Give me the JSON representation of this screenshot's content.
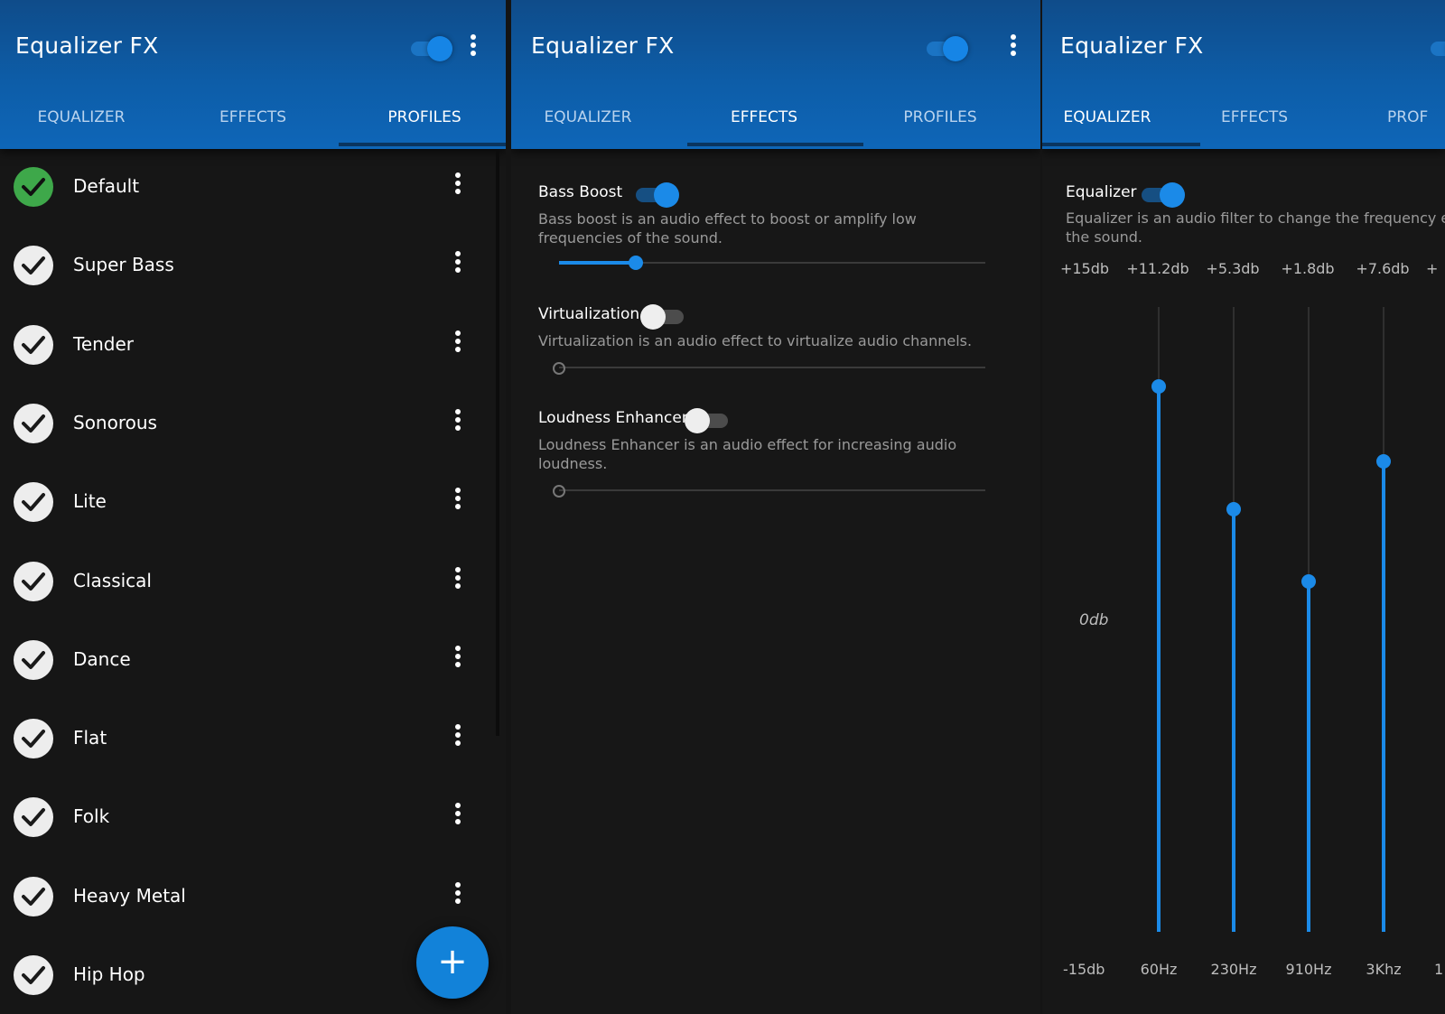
{
  "colors": {
    "accent": "#1b8ae8",
    "appbar": "#0d5da8",
    "background": "#161616",
    "check_active": "#3ea84a"
  },
  "panel_profiles": {
    "title": "Equalizer FX",
    "tabs": [
      "EQUALIZER",
      "EFFECTS",
      "PROFILES"
    ],
    "active_tab": "PROFILES",
    "profiles": [
      {
        "label": "Default",
        "selected": true
      },
      {
        "label": "Super Bass",
        "selected": false
      },
      {
        "label": "Tender",
        "selected": false
      },
      {
        "label": "Sonorous",
        "selected": false
      },
      {
        "label": "Lite",
        "selected": false
      },
      {
        "label": "Classical",
        "selected": false
      },
      {
        "label": "Dance",
        "selected": false
      },
      {
        "label": "Flat",
        "selected": false
      },
      {
        "label": "Folk",
        "selected": false
      },
      {
        "label": "Heavy Metal",
        "selected": false
      },
      {
        "label": "Hip Hop",
        "selected": false
      }
    ],
    "fab_label": "+"
  },
  "panel_effects": {
    "title": "Equalizer FX",
    "tabs": [
      "EQUALIZER",
      "EFFECTS",
      "PROFILES"
    ],
    "active_tab": "EFFECTS",
    "effects": [
      {
        "name": "Bass Boost",
        "enabled": true,
        "description_lines": [
          "Bass boost is an audio effect to boost or amplify low",
          "frequencies of the sound."
        ],
        "level": 0.18
      },
      {
        "name": "Virtualization",
        "enabled": false,
        "description_lines": [
          "Virtualization is an audio effect to virtualize audio channels."
        ],
        "level": 0
      },
      {
        "name": "Loudness Enhancer",
        "enabled": false,
        "description_lines": [
          "Loudness Enhancer is an audio effect for increasing audio",
          "loudness."
        ],
        "level": 0
      }
    ]
  },
  "panel_equalizer": {
    "title": "Equalizer FX",
    "tabs": [
      "EQUALIZER",
      "EFFECTS",
      "PROF"
    ],
    "active_tab": "EQUALIZER",
    "equalizer_label": "Equalizer",
    "equalizer_enabled": true,
    "description_lines": [
      "Equalizer is an audio filter to change the frequency enve",
      "the sound."
    ],
    "max_db_label": "+15db",
    "mid_db_label": "0db",
    "min_db_label": "-15db",
    "bands": [
      {
        "freq": "60Hz",
        "gain_label": "+11.2db",
        "gain": 11.2
      },
      {
        "freq": "230Hz",
        "gain_label": "+5.3db",
        "gain": 5.3
      },
      {
        "freq": "910Hz",
        "gain_label": "+1.8db",
        "gain": 1.8
      },
      {
        "freq": "3Khz",
        "gain_label": "+7.6db",
        "gain": 7.6
      }
    ],
    "clipped_gain_label": "+",
    "clipped_freq_label": "1"
  }
}
